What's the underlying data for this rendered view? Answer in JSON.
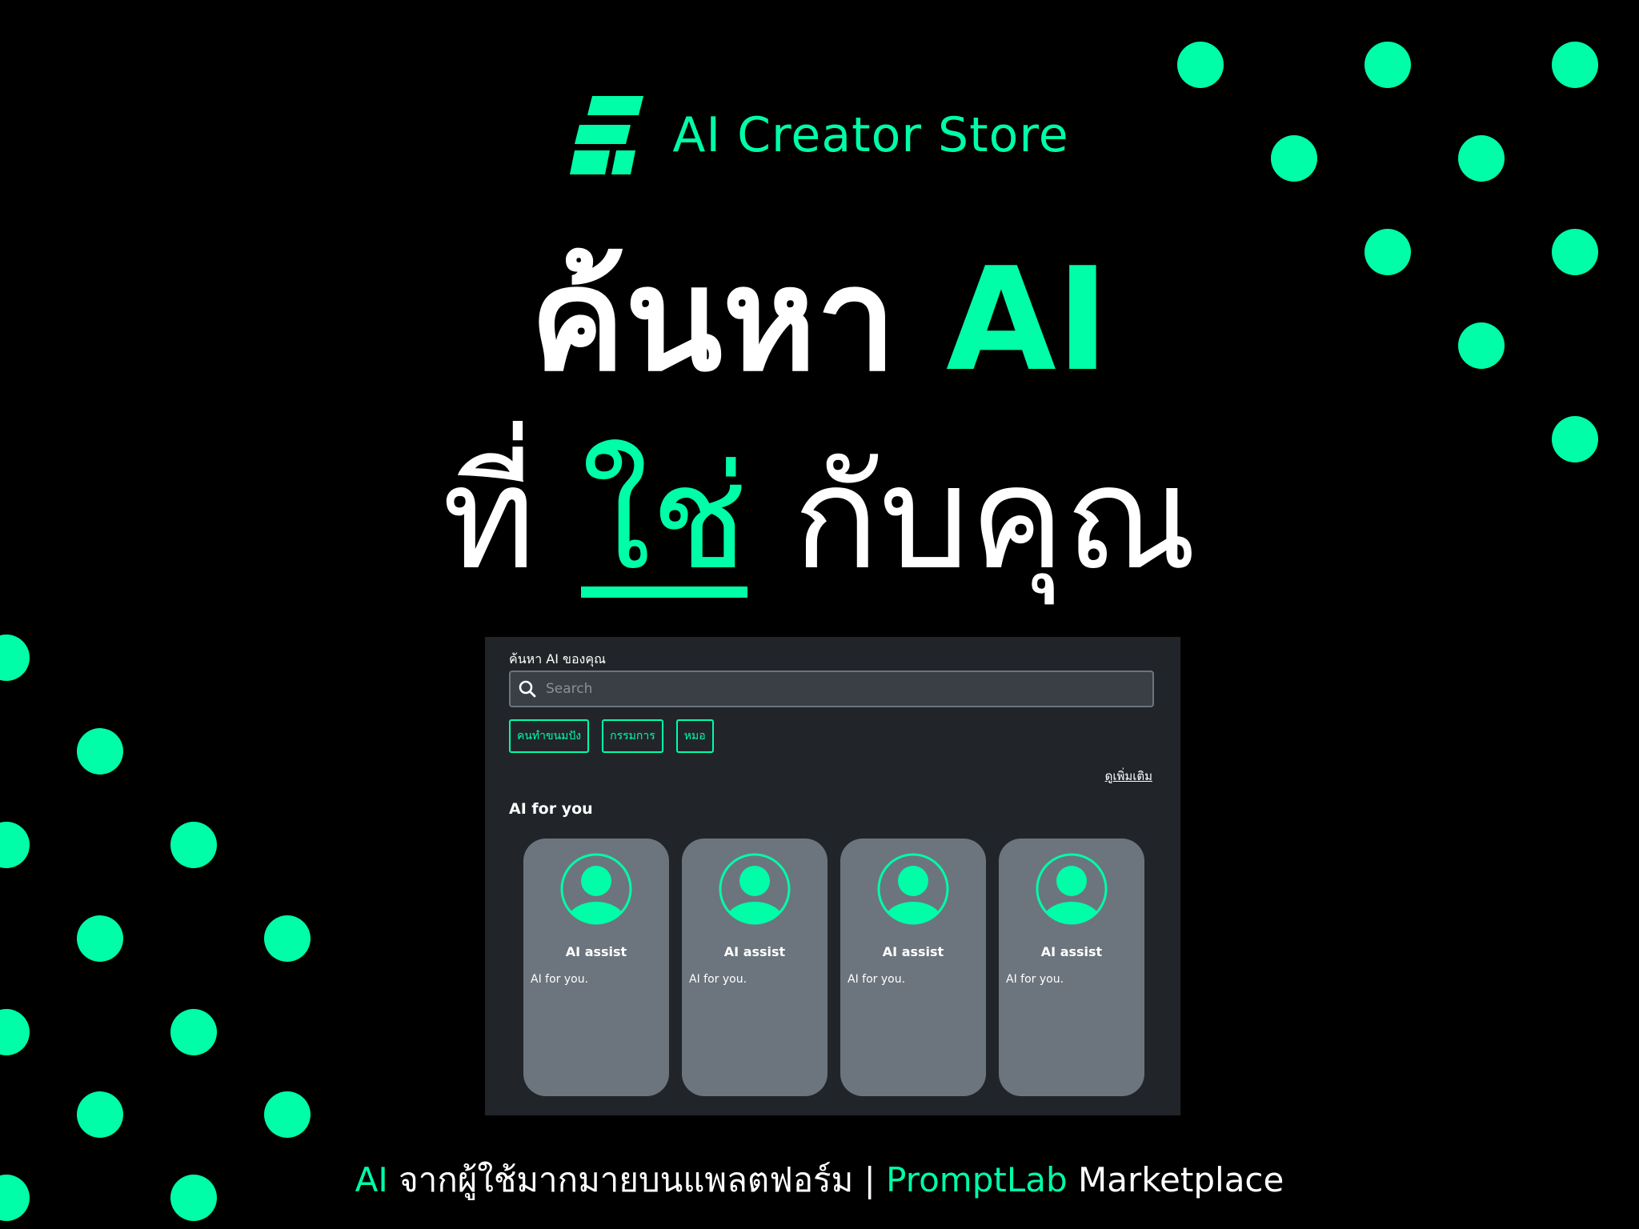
{
  "brand": {
    "name": "AI Creator Store",
    "logo_icon": "stacked-parallelogram-logo-icon"
  },
  "headline": {
    "line1_prefix": "ค้นหา",
    "line1_accent": "AI",
    "line2_prefix": "ที่",
    "line2_accent": "ใช่",
    "line2_suffix": "กับคุณ"
  },
  "app": {
    "search_label": "ค้นหา AI ของคุณ",
    "search_placeholder": "Search",
    "search_icon": "search-icon",
    "chips": [
      "คนทำขนมปัง",
      "กรรมการ",
      "หมอ"
    ],
    "see_more": "ดูเพิ่มเติม",
    "section_title": "AI for you",
    "cards": [
      {
        "title": "AI assist",
        "description": "AI for you."
      },
      {
        "title": "AI assist",
        "description": "AI for you."
      },
      {
        "title": "AI assist",
        "description": "AI for you."
      },
      {
        "title": "AI assist",
        "description": "AI for you."
      }
    ]
  },
  "footer": {
    "accent1": "AI",
    "text1": "จากผู้ใช้มากมายบนแพลตฟอร์ม |",
    "accent2": "PromptLab",
    "text2": "Marketplace"
  },
  "colors": {
    "accent": "#00FDA8",
    "background": "#000000",
    "panel": "#212529",
    "card": "#6C757D"
  }
}
